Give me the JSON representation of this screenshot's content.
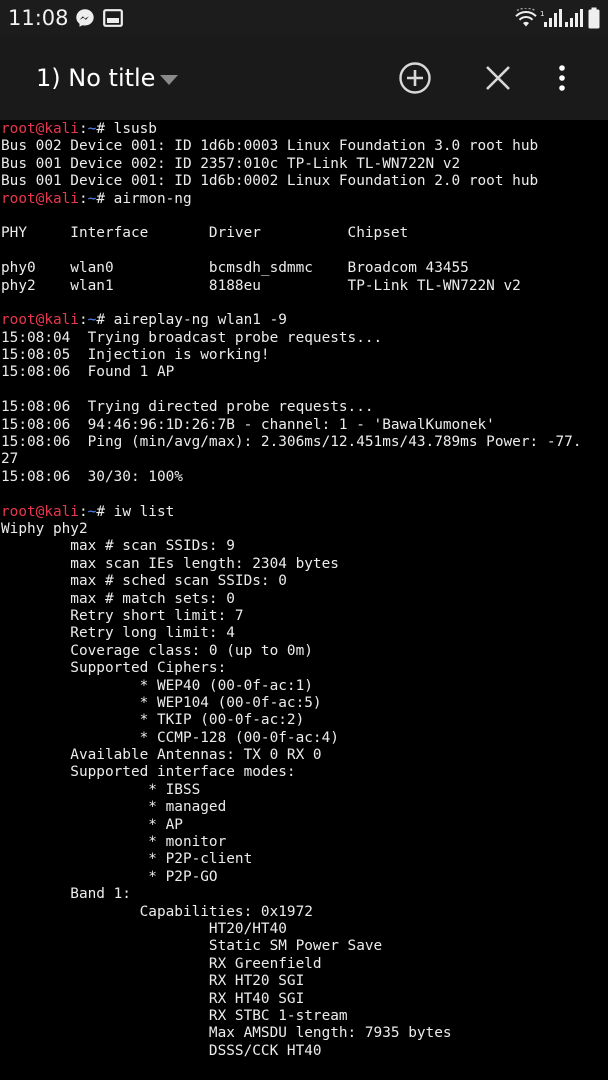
{
  "status_bar": {
    "time": "11:08",
    "icons": [
      "messenger-icon",
      "screen-icon",
      "wifi-icon",
      "signal-icon",
      "signal-icon",
      "battery-icon"
    ]
  },
  "toolbar": {
    "title": "1) No title",
    "actions": [
      "add-circle-icon",
      "close-icon",
      "more-vert-icon"
    ]
  },
  "colors": {
    "prompt_user": "#e8384d",
    "prompt_path": "#5a8cff",
    "text": "#ececec",
    "background": "#000000",
    "toolbar": "#1a1a1a"
  },
  "terminal": {
    "lines": [
      {
        "prompt": {
          "user": "root@kali",
          "sep": ":",
          "path": "~",
          "end": "# "
        },
        "text": "lsusb"
      },
      {
        "text": "Bus 002 Device 001: ID 1d6b:0003 Linux Foundation 3.0 root hub"
      },
      {
        "text": "Bus 001 Device 002: ID 2357:010c TP-Link TL-WN722N v2"
      },
      {
        "text": "Bus 001 Device 001: ID 1d6b:0002 Linux Foundation 2.0 root hub"
      },
      {
        "prompt": {
          "user": "root@kali",
          "sep": ":",
          "path": "~",
          "end": "# "
        },
        "text": "airmon-ng"
      },
      {
        "text": ""
      },
      {
        "text": "PHY     Interface       Driver          Chipset"
      },
      {
        "text": ""
      },
      {
        "text": "phy0    wlan0           bcmsdh_sdmmc    Broadcom 43455"
      },
      {
        "text": "phy2    wlan1           8188eu          TP-Link TL-WN722N v2"
      },
      {
        "text": ""
      },
      {
        "prompt": {
          "user": "root@kali",
          "sep": ":",
          "path": "~",
          "end": "# "
        },
        "text": "aireplay-ng wlan1 -9"
      },
      {
        "text": "15:08:04  Trying broadcast probe requests..."
      },
      {
        "text": "15:08:05  Injection is working!"
      },
      {
        "text": "15:08:06  Found 1 AP"
      },
      {
        "text": ""
      },
      {
        "text": "15:08:06  Trying directed probe requests..."
      },
      {
        "text": "15:08:06  94:46:96:1D:26:7B - channel: 1 - 'BawalKumonek'"
      },
      {
        "text": "15:08:06  Ping (min/avg/max): 2.306ms/12.451ms/43.789ms Power: -77."
      },
      {
        "text": "27"
      },
      {
        "text": "15:08:06  30/30: 100%"
      },
      {
        "text": ""
      },
      {
        "prompt": {
          "user": "root@kali",
          "sep": ":",
          "path": "~",
          "end": "# "
        },
        "text": "iw list"
      },
      {
        "text": "Wiphy phy2"
      },
      {
        "text": "        max # scan SSIDs: 9"
      },
      {
        "text": "        max scan IEs length: 2304 bytes"
      },
      {
        "text": "        max # sched scan SSIDs: 0"
      },
      {
        "text": "        max # match sets: 0"
      },
      {
        "text": "        Retry short limit: 7"
      },
      {
        "text": "        Retry long limit: 4"
      },
      {
        "text": "        Coverage class: 0 (up to 0m)"
      },
      {
        "text": "        Supported Ciphers:"
      },
      {
        "text": "                * WEP40 (00-0f-ac:1)"
      },
      {
        "text": "                * WEP104 (00-0f-ac:5)"
      },
      {
        "text": "                * TKIP (00-0f-ac:2)"
      },
      {
        "text": "                * CCMP-128 (00-0f-ac:4)"
      },
      {
        "text": "        Available Antennas: TX 0 RX 0"
      },
      {
        "text": "        Supported interface modes:"
      },
      {
        "text": "                 * IBSS"
      },
      {
        "text": "                 * managed"
      },
      {
        "text": "                 * AP"
      },
      {
        "text": "                 * monitor"
      },
      {
        "text": "                 * P2P-client"
      },
      {
        "text": "                 * P2P-GO"
      },
      {
        "text": "        Band 1:"
      },
      {
        "text": "                Capabilities: 0x1972"
      },
      {
        "text": "                        HT20/HT40"
      },
      {
        "text": "                        Static SM Power Save"
      },
      {
        "text": "                        RX Greenfield"
      },
      {
        "text": "                        RX HT20 SGI"
      },
      {
        "text": "                        RX HT40 SGI"
      },
      {
        "text": "                        RX STBC 1-stream"
      },
      {
        "text": "                        Max AMSDU length: 7935 bytes"
      },
      {
        "text": "                        DSSS/CCK HT40"
      }
    ]
  }
}
